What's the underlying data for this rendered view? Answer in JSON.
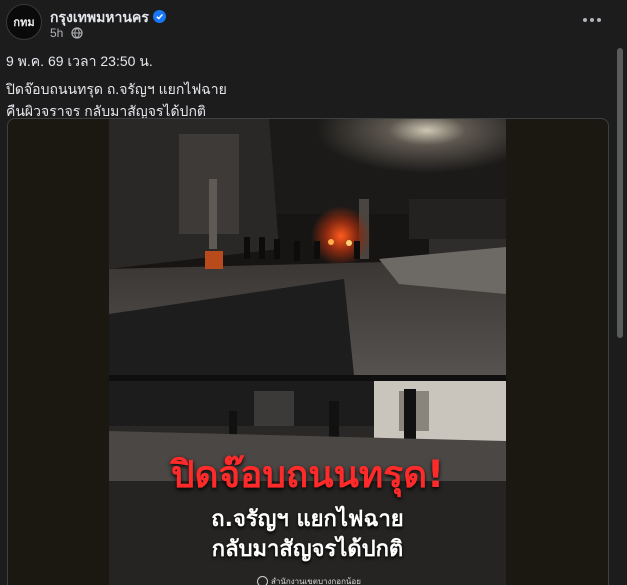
{
  "post": {
    "page_name": "กรุงเทพมหานคร",
    "avatar_text": "กทม",
    "time_ago": "5h",
    "date_line": "9 พ.ค. 69 เวลา 23:50 น.",
    "lines": [
      "ปิดจ๊อบถนนทรุด ถ.จรัญฯ แยกไฟฉาย",
      "คืนผิวจราจร กลับมาสัญจรได้ปกติ"
    ]
  },
  "image": {
    "headline": "ปิดจ๊อบถนนทรุด!",
    "subline1": "ถ.จรัญฯ แยกไฟฉาย",
    "subline2": "กลับมาสัญจรได้ปกติ",
    "agency": "สำนักงานเขตบางกอกน้อย"
  },
  "colors": {
    "background": "#1c1c1d",
    "text_primary": "#e4e6eb",
    "text_secondary": "#b0b3b8",
    "verified_badge": "#1877f2",
    "headline_red": "#ff2a2a"
  },
  "icons": [
    "verified-badge-icon",
    "globe-icon",
    "more-options-icon"
  ]
}
